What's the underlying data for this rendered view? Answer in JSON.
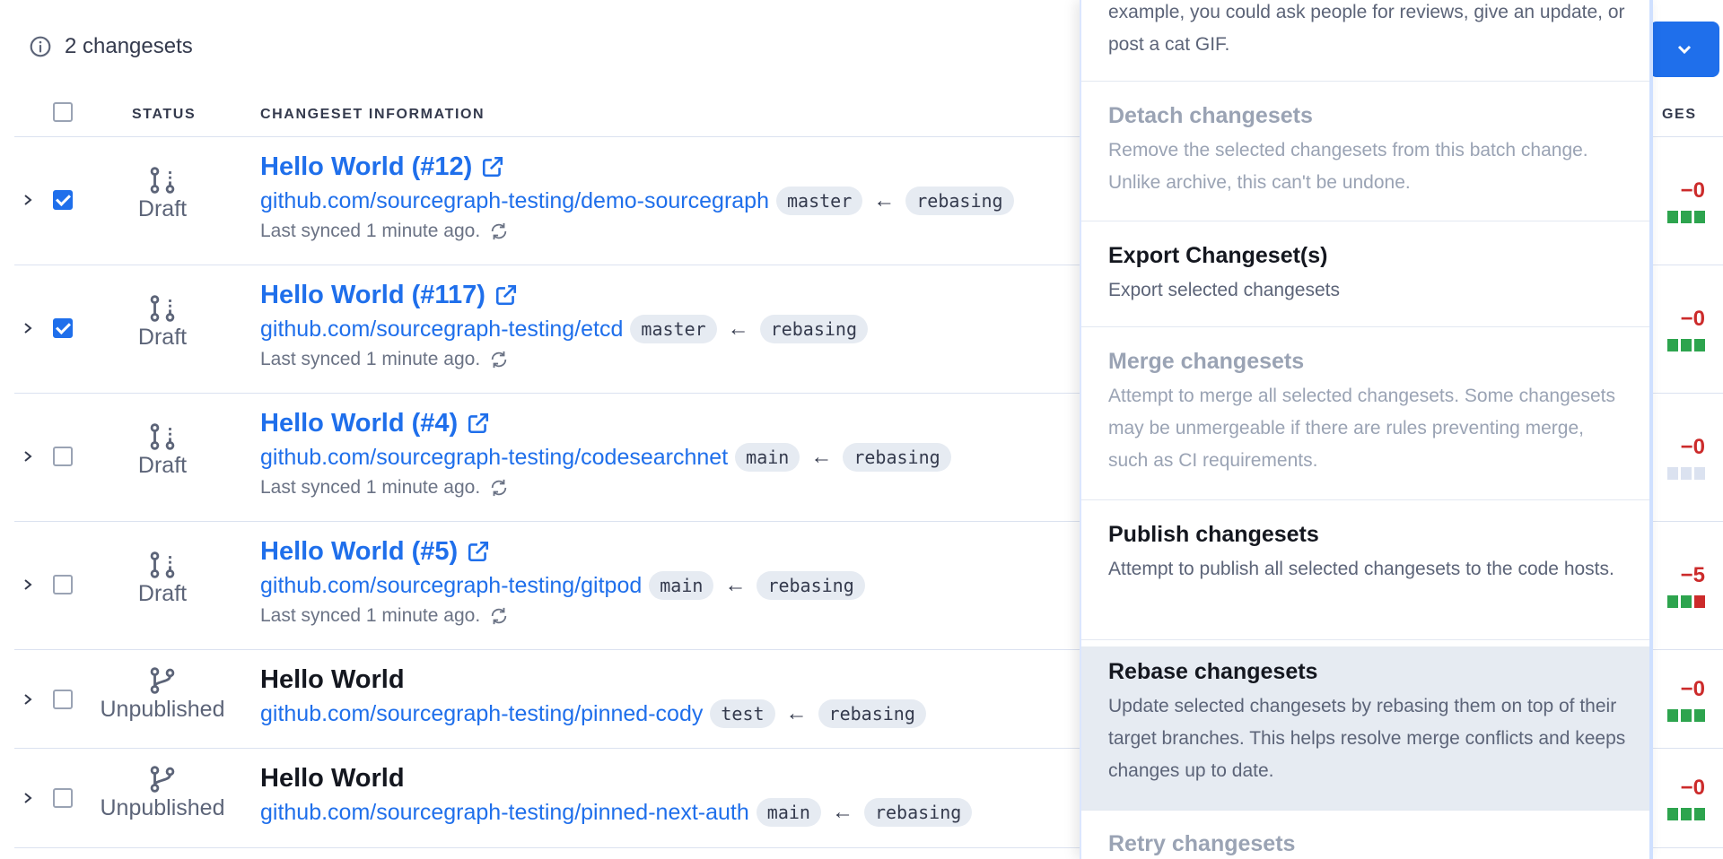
{
  "summary": {
    "count_text": "2 changesets"
  },
  "table": {
    "headers": {
      "status": "STATUS",
      "info": "CHANGESET INFORMATION",
      "changes": "GES"
    },
    "rows": [
      {
        "title": "Hello World (#12)",
        "repo": "github.com/sourcegraph-testing/demo-sourcegraph",
        "base": "master",
        "head": "rebasing",
        "status": "Draft",
        "synced": "Last synced 1 minute ago.",
        "checked": true,
        "diff": "−0"
      },
      {
        "title": "Hello World (#117)",
        "repo": "github.com/sourcegraph-testing/etcd",
        "base": "master",
        "head": "rebasing",
        "status": "Draft",
        "synced": "Last synced 1 minute ago.",
        "checked": true,
        "diff": "−0"
      },
      {
        "title": "Hello World (#4)",
        "repo": "github.com/sourcegraph-testing/codesearchnet",
        "base": "main",
        "head": "rebasing",
        "status": "Draft",
        "synced": "Last synced 1 minute ago.",
        "checked": false,
        "diff": "−0"
      },
      {
        "title": "Hello World (#5)",
        "repo": "github.com/sourcegraph-testing/gitpod",
        "base": "main",
        "head": "rebasing",
        "status": "Draft",
        "synced": "Last synced 1 minute ago.",
        "checked": false,
        "diff": "−5"
      },
      {
        "title": "Hello World",
        "repo": "github.com/sourcegraph-testing/pinned-cody",
        "base": "test",
        "head": "rebasing",
        "status": "Unpublished",
        "checked": false,
        "diff": "−0"
      },
      {
        "title": "Hello World",
        "repo": "github.com/sourcegraph-testing/pinned-next-auth",
        "base": "main",
        "head": "rebasing",
        "status": "Unpublished",
        "checked": false,
        "diff": "−0"
      }
    ]
  },
  "arrow_glyph": "←",
  "menu": {
    "items": [
      {
        "title": "",
        "description": "example, you could ask people for reviews, give an update, or post a cat GIF."
      },
      {
        "title": "Detach changesets",
        "description": "Remove the selected changesets from this batch change. Unlike archive, this can't be undone."
      },
      {
        "title": "Export Changeset(s)",
        "description": "Export selected changesets"
      },
      {
        "title": "Merge changesets",
        "description": "Attempt to merge all selected changesets. Some changesets may be unmergeable if there are rules preventing merge, such as CI requirements."
      },
      {
        "title": "Publish changesets",
        "description": "Attempt to publish all selected changesets to the code hosts."
      },
      {
        "title": "Rebase changesets",
        "description": "Update selected changesets by rebasing them on top of their target branches. This helps resolve merge conflicts and keeps changes up to date."
      },
      {
        "title": "Retry changesets",
        "description": ""
      }
    ]
  },
  "colors": {
    "accent": "#1f6feb",
    "added": "#2da44e",
    "removed": "#cc2b2b",
    "neutral": "#dbe2f0"
  }
}
